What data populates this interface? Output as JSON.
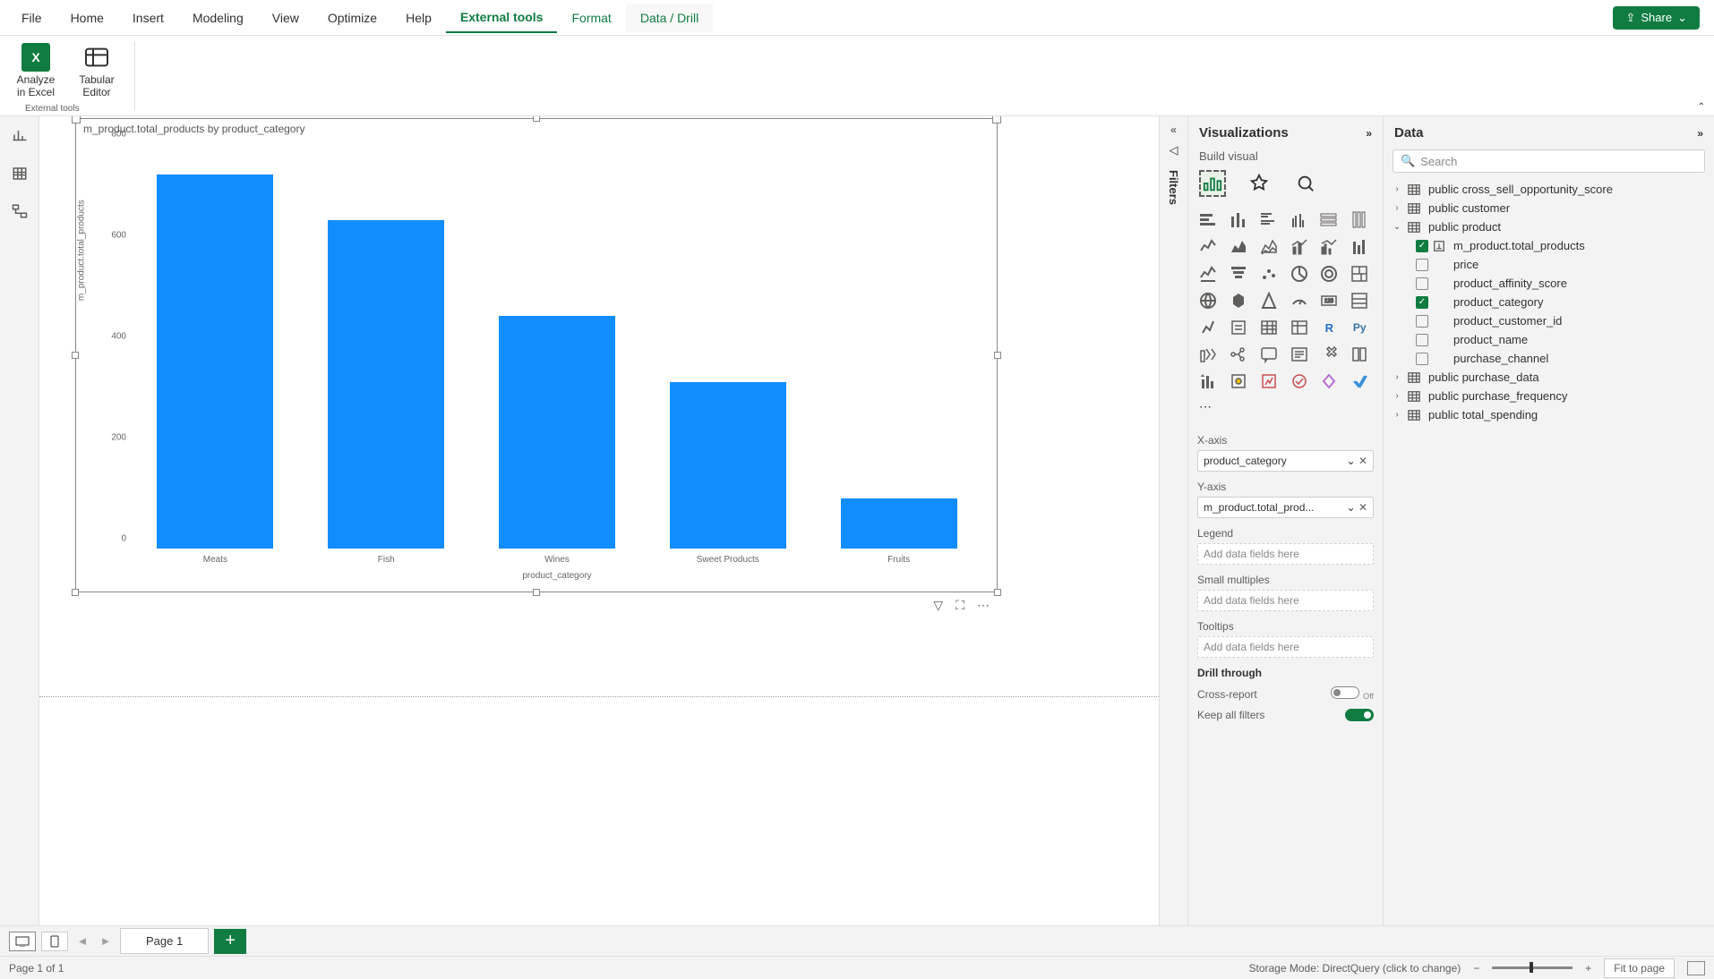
{
  "ribbon": {
    "tabs": [
      "File",
      "Home",
      "Insert",
      "Modeling",
      "View",
      "Optimize",
      "Help",
      "External tools",
      "Format",
      "Data / Drill"
    ],
    "active_tab": "External tools",
    "share": "Share"
  },
  "toolbar": {
    "analyze_excel": "Analyze in Excel",
    "tabular_editor": "Tabular Editor",
    "group_label": "External tools"
  },
  "visual": {
    "title": "m_product.total_products by product_category",
    "ylabel": "m_product.total_products",
    "xlabel": "product_category"
  },
  "chart_data": {
    "type": "bar",
    "categories": [
      "Meats",
      "Fish",
      "Wines",
      "Sweet Products",
      "Fruits"
    ],
    "values": [
      740,
      650,
      460,
      330,
      100
    ],
    "title": "m_product.total_products by product_category",
    "xlabel": "product_category",
    "ylabel": "m_product.total_products",
    "ylim": [
      0,
      800
    ],
    "yticks": [
      0,
      200,
      400,
      600,
      800
    ]
  },
  "viz_pane": {
    "title": "Visualizations",
    "subtitle": "Build visual",
    "wells": {
      "xaxis_label": "X-axis",
      "xaxis_value": "product_category",
      "yaxis_label": "Y-axis",
      "yaxis_value": "m_product.total_prod...",
      "legend_label": "Legend",
      "legend_placeholder": "Add data fields here",
      "small_label": "Small multiples",
      "small_placeholder": "Add data fields here",
      "tooltips_label": "Tooltips",
      "tooltips_placeholder": "Add data fields here",
      "drill_label": "Drill through",
      "cross_report": "Cross-report",
      "cross_off": "Off",
      "keep_filters": "Keep all filters"
    }
  },
  "data_pane": {
    "title": "Data",
    "search_placeholder": "Search",
    "tables": [
      {
        "name": "public cross_sell_opportunity_score",
        "expanded": false
      },
      {
        "name": "public customer",
        "expanded": false
      },
      {
        "name": "public product",
        "expanded": true,
        "fields": [
          {
            "name": "m_product.total_products",
            "checked": true,
            "type": "measure"
          },
          {
            "name": "price",
            "checked": false,
            "type": "column"
          },
          {
            "name": "product_affinity_score",
            "checked": false,
            "type": "column"
          },
          {
            "name": "product_category",
            "checked": true,
            "type": "column"
          },
          {
            "name": "product_customer_id",
            "checked": false,
            "type": "column"
          },
          {
            "name": "product_name",
            "checked": false,
            "type": "column"
          },
          {
            "name": "purchase_channel",
            "checked": false,
            "type": "column"
          }
        ]
      },
      {
        "name": "public purchase_data",
        "expanded": false
      },
      {
        "name": "public purchase_frequency",
        "expanded": false
      },
      {
        "name": "public total_spending",
        "expanded": false
      }
    ]
  },
  "filters_pane": {
    "label": "Filters"
  },
  "page_bar": {
    "page1": "Page 1"
  },
  "status": {
    "page_info": "Page 1 of 1",
    "storage_mode": "Storage Mode: DirectQuery (click to change)",
    "fit": "Fit to page"
  }
}
